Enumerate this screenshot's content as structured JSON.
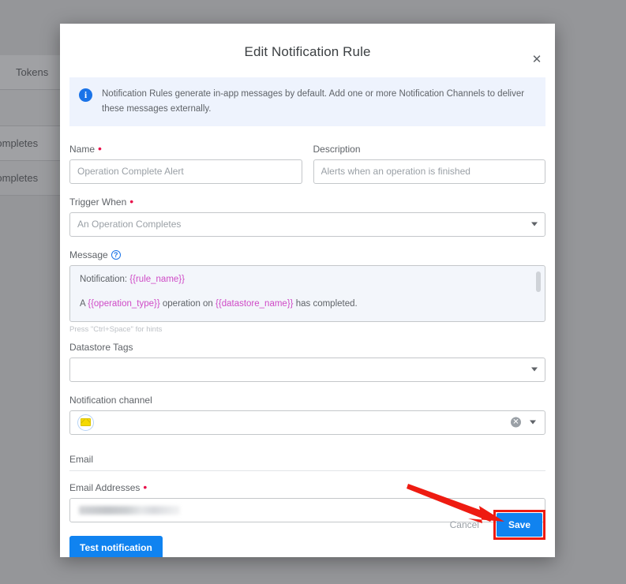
{
  "background": {
    "column_header": "Tokens",
    "rows": [
      {
        "label": "Completes"
      },
      {
        "label": "Completes"
      }
    ]
  },
  "modal": {
    "title": "Edit Notification Rule",
    "close_icon": "close-icon",
    "banner": {
      "icon": "info-icon",
      "text": "Notification Rules generate in-app messages by default. Add one or more Notification Channels to deliver these messages externally."
    },
    "fields": {
      "name": {
        "label": "Name",
        "required": true,
        "value": "",
        "placeholder": "Operation Complete Alert"
      },
      "description": {
        "label": "Description",
        "required": false,
        "value": "",
        "placeholder": "Alerts when an operation is finished"
      },
      "trigger_when": {
        "label": "Trigger When",
        "required": true,
        "selected": "An Operation Completes",
        "caret_icon": "chevron-down-icon"
      },
      "message": {
        "label": "Message",
        "help_icon": "help-circle-icon",
        "lines": [
          [
            {
              "text": "Notification: ",
              "kind": "plain"
            },
            {
              "text": "{{rule_name}}",
              "kind": "var"
            }
          ],
          [
            {
              "text": "A ",
              "kind": "plain"
            },
            {
              "text": "{{operation_type}}",
              "kind": "var"
            },
            {
              "text": " operation on ",
              "kind": "plain"
            },
            {
              "text": "{{datastore_name}}",
              "kind": "var"
            },
            {
              "text": " has completed.",
              "kind": "plain"
            }
          ]
        ],
        "hint": "Press \"Ctrl+Space\" for hints",
        "var_color": "#cf4ac6"
      },
      "datastore_tags": {
        "label": "Datastore Tags",
        "selected": "",
        "caret_icon": "chevron-down-icon"
      },
      "notification_channel": {
        "label": "Notification channel",
        "chip_icon": "email-envelope-icon",
        "clear_icon": "clear-circle-icon",
        "caret_icon": "chevron-down-icon"
      }
    },
    "email_section": {
      "title": "Email",
      "addresses": {
        "label": "Email Addresses",
        "required": true,
        "value": "",
        "redacted": true
      },
      "test_button": "Test notification"
    },
    "footer": {
      "cancel_label": "Cancel",
      "save_label": "Save"
    }
  },
  "annotation": {
    "arrow_color": "#ee1b11",
    "highlight_color": "#ee1b11",
    "target": "save-button"
  },
  "colors": {
    "primary": "#1083f0",
    "required": "#e8114b",
    "banner_bg": "#eef3fd",
    "backdrop": "#959699"
  }
}
